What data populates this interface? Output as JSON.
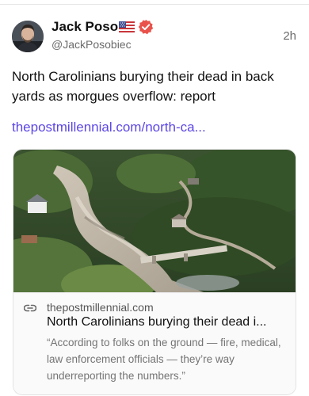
{
  "post": {
    "author": {
      "name": "Jack Poso",
      "flag_icon": "us-flag-icon",
      "verified_icon": "verified-badge-icon",
      "handle": "@JackPosobiec"
    },
    "timestamp": "2h",
    "text": "North Carolinians burying their dead in back yards as morgues overflow: report",
    "link_text": "thepostmillennial.com/north-ca...",
    "card": {
      "domain": "thepostmillennial.com",
      "title": "North Carolinians burying their dead i...",
      "description": "“According to folks on the ground — fire, medical, law enforcement officials — they’re way underreporting the numbers.”"
    }
  },
  "colors": {
    "link": "#5b46e6",
    "verified": "#e9524a",
    "muted": "#6b6b6b"
  }
}
